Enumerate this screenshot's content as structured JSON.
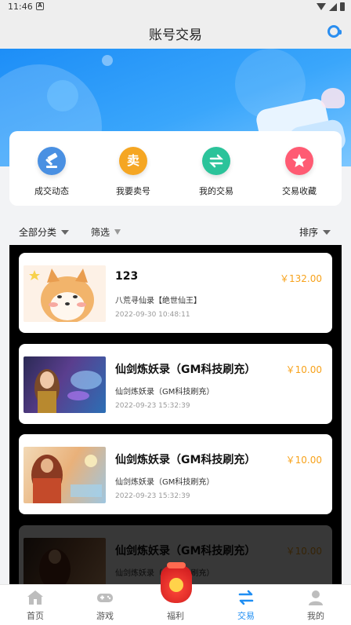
{
  "status_bar": {
    "time": "11:46"
  },
  "header": {
    "title": "账号交易"
  },
  "quick_actions": [
    {
      "label": "成交动态",
      "icon": "gavel-icon",
      "color": "#4a90e2"
    },
    {
      "label": "我要卖号",
      "icon": "sell-icon",
      "glyph": "卖",
      "color": "#f5a623"
    },
    {
      "label": "我的交易",
      "icon": "exchange-icon",
      "color": "#2bc39a"
    },
    {
      "label": "交易收藏",
      "icon": "star-icon",
      "color": "#ff5b73"
    }
  ],
  "filters": {
    "category": "全部分类",
    "filter": "筛选",
    "sort": "排序"
  },
  "listings": [
    {
      "title": "123",
      "price": "￥132.00",
      "server": "八荒寻仙录【绝世仙王】",
      "date": "2022-09-30 10:48:11"
    },
    {
      "title": "仙剑炼妖录（GM科技刷充）",
      "price": "￥10.00",
      "server": "仙剑炼妖录（GM科技刷充）",
      "date": "2022-09-23 15:32:39"
    },
    {
      "title": "仙剑炼妖录（GM科技刷充）",
      "price": "￥10.00",
      "server": "仙剑炼妖录（GM科技刷充）",
      "date": "2022-09-23 15:32:39"
    },
    {
      "title": "仙剑炼妖录（GM科技刷充）",
      "price": "￥10.00",
      "server": "仙剑炼妖录（GM科技刷充）",
      "date": ""
    }
  ],
  "tabs": [
    {
      "label": "首页",
      "icon": "home-icon"
    },
    {
      "label": "游戏",
      "icon": "gamepad-icon"
    },
    {
      "label": "福利",
      "icon": "welfare-bag-icon"
    },
    {
      "label": "交易",
      "icon": "exchange-arrows-icon",
      "active": true
    },
    {
      "label": "我的",
      "icon": "profile-icon"
    }
  ],
  "colors": {
    "accent": "#1f8ef3",
    "price": "#f7a21b"
  }
}
